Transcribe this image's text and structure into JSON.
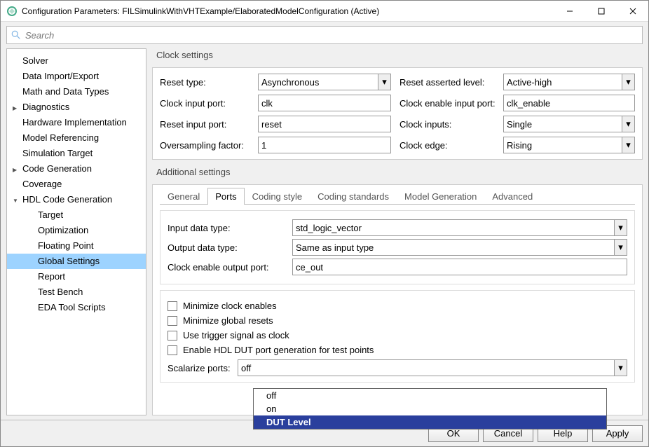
{
  "window": {
    "title": "Configuration Parameters: FILSimulinkWithVHTExample/ElaboratedModelConfiguration (Active)"
  },
  "search": {
    "placeholder": "Search"
  },
  "nav": [
    {
      "label": "Solver",
      "sel": false,
      "lvl": 0
    },
    {
      "label": "Data Import/Export",
      "sel": false,
      "lvl": 0
    },
    {
      "label": "Math and Data Types",
      "sel": false,
      "lvl": 0
    },
    {
      "label": "Diagnostics",
      "sel": false,
      "lvl": 0,
      "caret": "right"
    },
    {
      "label": "Hardware Implementation",
      "sel": false,
      "lvl": 0
    },
    {
      "label": "Model Referencing",
      "sel": false,
      "lvl": 0
    },
    {
      "label": "Simulation Target",
      "sel": false,
      "lvl": 0
    },
    {
      "label": "Code Generation",
      "sel": false,
      "lvl": 0,
      "caret": "right"
    },
    {
      "label": "Coverage",
      "sel": false,
      "lvl": 0
    },
    {
      "label": "HDL Code Generation",
      "sel": false,
      "lvl": 0,
      "caret": "down"
    },
    {
      "label": "Target",
      "sel": false,
      "lvl": 2
    },
    {
      "label": "Optimization",
      "sel": false,
      "lvl": 2
    },
    {
      "label": "Floating Point",
      "sel": false,
      "lvl": 2
    },
    {
      "label": "Global Settings",
      "sel": true,
      "lvl": 2
    },
    {
      "label": "Report",
      "sel": false,
      "lvl": 2
    },
    {
      "label": "Test Bench",
      "sel": false,
      "lvl": 2
    },
    {
      "label": "EDA Tool Scripts",
      "sel": false,
      "lvl": 2
    }
  ],
  "clock": {
    "title": "Clock settings",
    "reset_type_lbl": "Reset type:",
    "reset_type": "Asynchronous",
    "reset_asserted_lbl": "Reset asserted level:",
    "reset_asserted": "Active-high",
    "clk_port_lbl": "Clock input port:",
    "clk_port": "clk",
    "clk_en_port_lbl": "Clock enable input port:",
    "clk_en_port": "clk_enable",
    "reset_port_lbl": "Reset input port:",
    "reset_port": "reset",
    "clk_inputs_lbl": "Clock inputs:",
    "clk_inputs": "Single",
    "ovs_lbl": "Oversampling factor:",
    "ovs": "1",
    "clk_edge_lbl": "Clock edge:",
    "clk_edge": "Rising"
  },
  "additional": {
    "title": "Additional settings",
    "tabs": [
      "General",
      "Ports",
      "Coding style",
      "Coding standards",
      "Model Generation",
      "Advanced"
    ],
    "active_tab": 1,
    "input_dt_lbl": "Input data type:",
    "input_dt": "std_logic_vector",
    "output_dt_lbl": "Output data type:",
    "output_dt": "Same as input type",
    "ce_out_lbl": "Clock enable output port:",
    "ce_out": "ce_out",
    "chk_min_clock": "Minimize clock enables",
    "chk_min_reset": "Minimize global resets",
    "chk_trigger": "Use trigger signal as clock",
    "chk_hdldut": "Enable HDL DUT port generation for test points",
    "scal_lbl": "Scalarize ports:",
    "scal_val": "off",
    "scal_opts": [
      "off",
      "on",
      "DUT Level"
    ],
    "scal_sel": 2
  },
  "footer": {
    "ok": "OK",
    "cancel": "Cancel",
    "help": "Help",
    "apply": "Apply"
  }
}
